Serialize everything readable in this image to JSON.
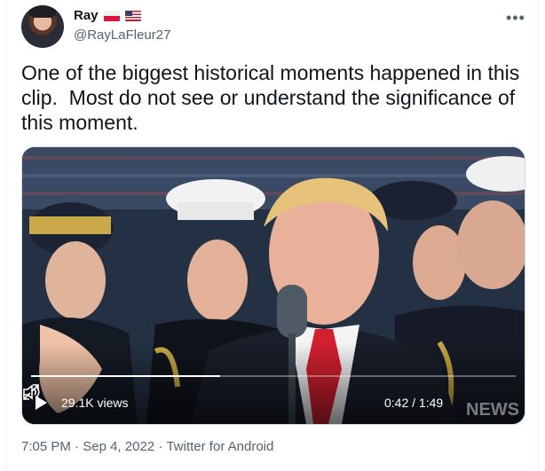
{
  "author": {
    "name": "Ray",
    "handle": "@RayLaFleur27",
    "flags": [
      "poland-flag-icon",
      "us-flag-icon"
    ]
  },
  "tweet": {
    "text": "One of the biggest historical moments happened in this clip.  Most do not see or understand the significance of this moment."
  },
  "video": {
    "views": "29.1K views",
    "time": "0:42 / 1:49",
    "watermark": "NEWS",
    "progress_fraction": 0.39
  },
  "footer": {
    "time": "7:05 PM",
    "sep1": " · ",
    "date": "Sep 4, 2022",
    "sep2": " · ",
    "source": "Twitter for Android"
  },
  "colors": {
    "text": "#0f1419",
    "secondary": "#536471",
    "border": "#cfd9de",
    "tie": "#d32030"
  },
  "icons": {
    "more": "more-options-icon",
    "play": "play-icon",
    "volume": "volume-icon",
    "expand": "fullscreen-icon"
  }
}
